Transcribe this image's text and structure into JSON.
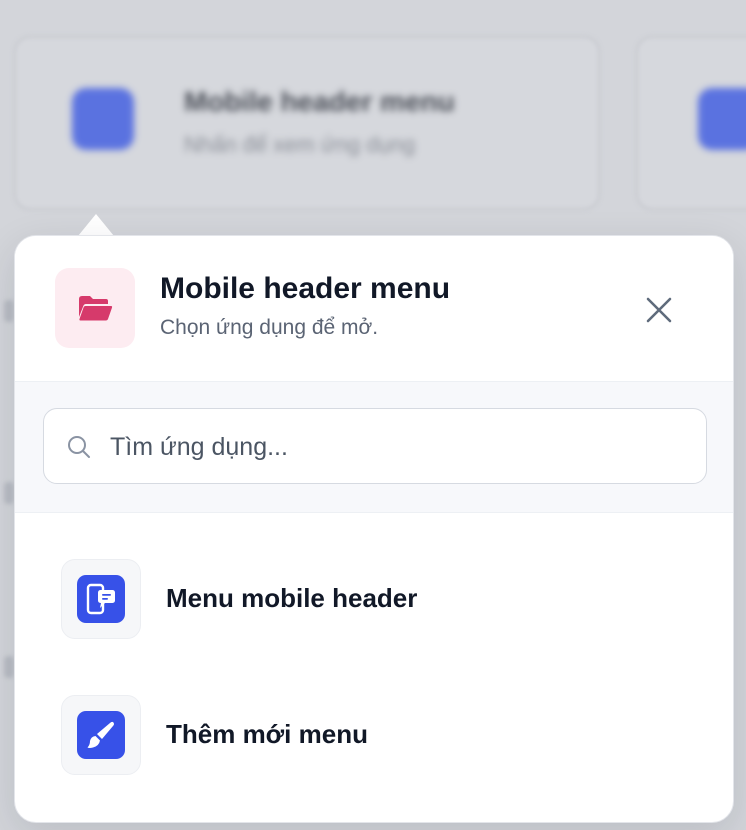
{
  "background": {
    "card_title": "Mobile header menu",
    "card_subtitle": "Nhấn để xem ứng dụng"
  },
  "popover": {
    "title": "Mobile header menu",
    "subtitle": "Chọn ứng dụng để mở.",
    "header_icon": "folder-open-icon",
    "close_icon": "close-icon"
  },
  "search": {
    "placeholder": "Tìm ứng dụng...",
    "value": ""
  },
  "apps": [
    {
      "label": "Menu mobile header",
      "icon": "mobile-chat-icon"
    },
    {
      "label": "Thêm mới menu",
      "icon": "paintbrush-icon"
    }
  ],
  "colors": {
    "accent": "#3751e8",
    "header_icon_bg": "#fdecf1",
    "header_icon_fg": "#d63a6b",
    "title": "#111827",
    "subtitle": "#5b6474"
  }
}
